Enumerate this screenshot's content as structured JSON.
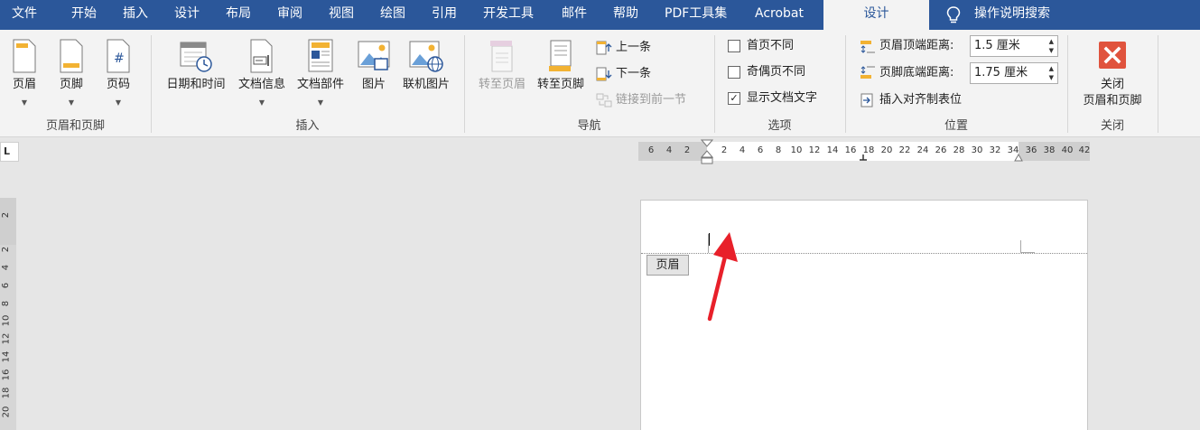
{
  "tabs": [
    {
      "label": "文件"
    },
    {
      "label": "开始"
    },
    {
      "label": "插入"
    },
    {
      "label": "设计"
    },
    {
      "label": "布局"
    },
    {
      "label": "审阅"
    },
    {
      "label": "视图"
    },
    {
      "label": "绘图"
    },
    {
      "label": "引用"
    },
    {
      "label": "开发工具"
    },
    {
      "label": "邮件"
    },
    {
      "label": "帮助"
    },
    {
      "label": "PDF工具集"
    },
    {
      "label": "Acrobat"
    },
    {
      "label": "设计"
    }
  ],
  "active_tab_index": 14,
  "tell_me": {
    "label": "操作说明搜索",
    "icon": "lightbulb-icon"
  },
  "ribbon": {
    "groups": {
      "header_footer": {
        "label": "页眉和页脚",
        "buttons": [
          {
            "label": "页眉",
            "icon": "header-icon"
          },
          {
            "label": "页脚",
            "icon": "footer-icon"
          },
          {
            "label": "页码",
            "icon": "page-number-icon"
          }
        ]
      },
      "insert": {
        "label": "插入",
        "buttons": [
          {
            "label": "日期和时间",
            "icon": "calendar-clock-icon"
          },
          {
            "label": "文档信息",
            "icon": "document-info-icon"
          },
          {
            "label": "文档部件",
            "icon": "quick-parts-icon"
          },
          {
            "label": "图片",
            "icon": "picture-icon"
          },
          {
            "label": "联机图片",
            "icon": "online-picture-icon"
          }
        ]
      },
      "navigation": {
        "label": "导航",
        "buttons": [
          {
            "label": "转至页眉",
            "icon": "goto-header-icon",
            "enabled": false
          },
          {
            "label": "转至页脚",
            "icon": "goto-footer-icon",
            "enabled": true
          }
        ],
        "small": [
          {
            "label": "上一条",
            "icon": "previous-icon",
            "enabled": true
          },
          {
            "label": "下一条",
            "icon": "next-icon",
            "enabled": true
          },
          {
            "label": "链接到前一节",
            "icon": "link-previous-icon",
            "enabled": false
          }
        ]
      },
      "options": {
        "label": "选项",
        "checks": [
          {
            "label": "首页不同",
            "checked": false
          },
          {
            "label": "奇偶页不同",
            "checked": false
          },
          {
            "label": "显示文档文字",
            "checked": true
          }
        ]
      },
      "position": {
        "label": "位置",
        "header_top": {
          "label": "页眉顶端距离:",
          "value": "1.5 厘米"
        },
        "footer_bottom": {
          "label": "页脚底端距离:",
          "value": "1.75 厘米"
        },
        "insert_tab": {
          "label": "插入对齐制表位"
        }
      },
      "close": {
        "label": "关闭",
        "button": {
          "line1": "关闭",
          "line2": "页眉和页脚",
          "icon": "close-x-icon",
          "color": "#e0533d"
        }
      }
    }
  },
  "rulers": {
    "corner_symbol": "L",
    "horizontal_ticks": [
      "6",
      "4",
      "2",
      "2",
      "4",
      "6",
      "8",
      "10",
      "12",
      "14",
      "16",
      "18",
      "20",
      "22",
      "24",
      "26",
      "28",
      "30",
      "32",
      "34",
      "36",
      "38",
      "40",
      "42"
    ],
    "vertical_ticks": [
      "2",
      "2",
      "4",
      "6",
      "8",
      "10",
      "12",
      "14",
      "16",
      "18",
      "20"
    ]
  },
  "document": {
    "header_tag": "页眉"
  },
  "colors": {
    "title_bar": "#2b579a",
    "ribbon_bg": "#f3f3f3",
    "arrow": "#e8202a"
  }
}
